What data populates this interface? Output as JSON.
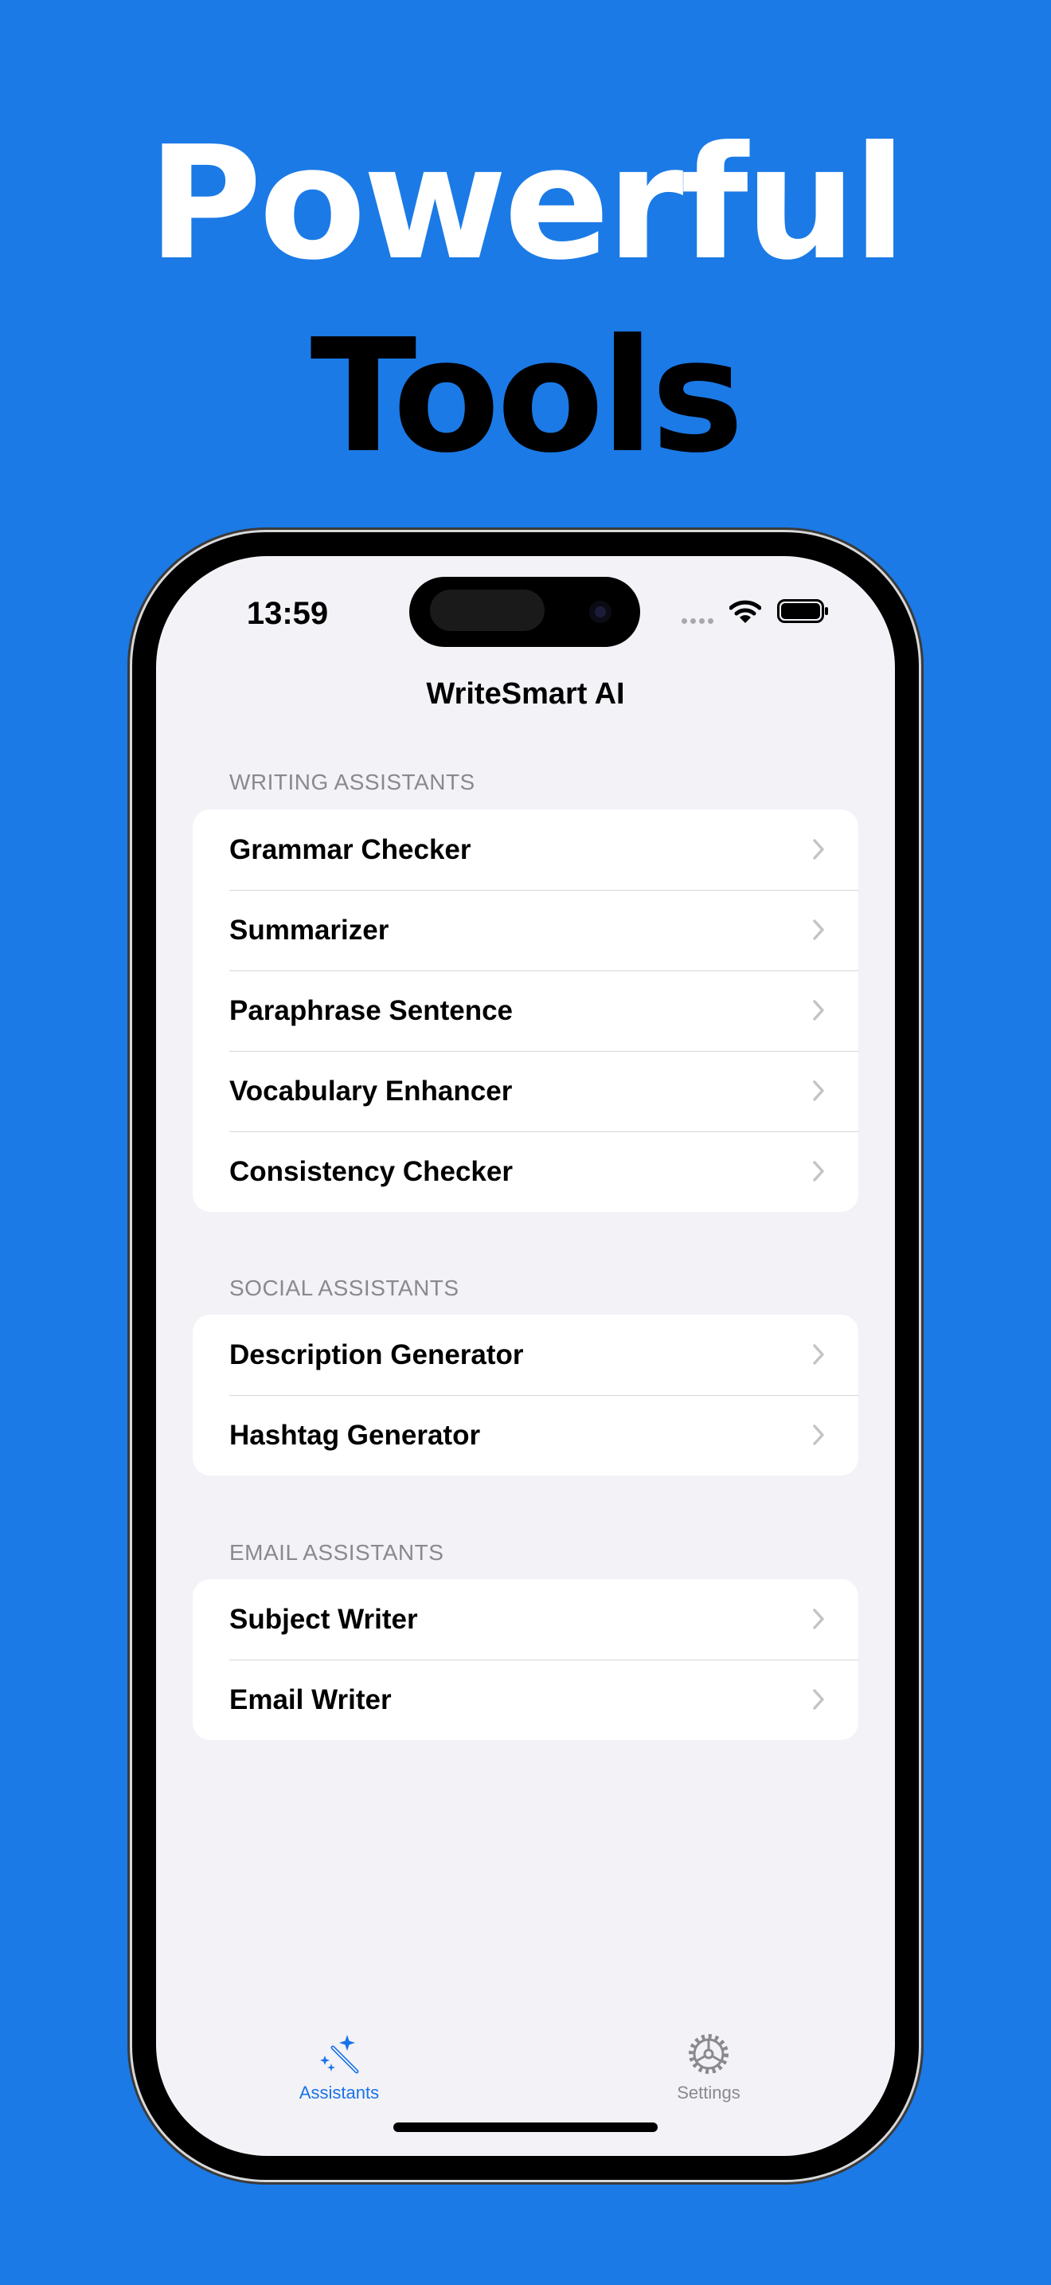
{
  "headline": {
    "line1": "Powerful",
    "line2": "Tools"
  },
  "status_bar": {
    "time": "13:59"
  },
  "nav": {
    "title": "WriteSmart AI"
  },
  "sections": [
    {
      "header": "WRITING ASSISTANTS",
      "items": [
        "Grammar Checker",
        "Summarizer",
        "Paraphrase Sentence",
        "Vocabulary Enhancer",
        "Consistency Checker"
      ]
    },
    {
      "header": "SOCIAL ASSISTANTS",
      "items": [
        "Description Generator",
        "Hashtag Generator"
      ]
    },
    {
      "header": "EMAIL ASSISTANTS",
      "items": [
        "Subject Writer",
        "Email Writer"
      ]
    }
  ],
  "tabbar": {
    "tabs": [
      {
        "label": "Assistants",
        "icon": "magic-wand-icon",
        "active": true
      },
      {
        "label": "Settings",
        "icon": "gear-icon",
        "active": false
      }
    ]
  },
  "colors": {
    "background": "#1b7ae6",
    "accent": "#1a73e8",
    "screen": "#f2f2f7"
  }
}
